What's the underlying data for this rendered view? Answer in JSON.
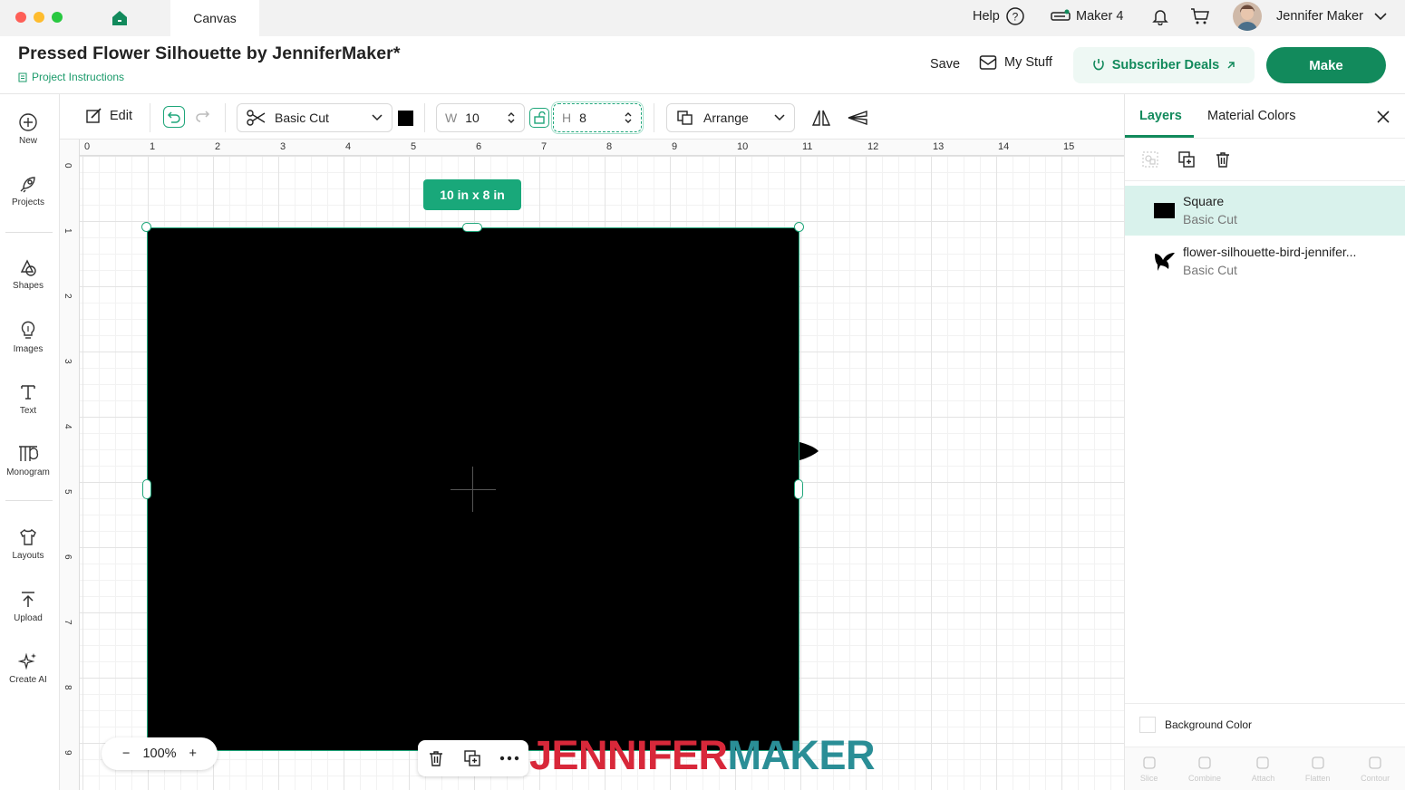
{
  "window": {
    "tab_label": "Canvas"
  },
  "topbar": {
    "help_label": "Help",
    "machine_label": "Maker 4",
    "user_name": "Jennifer Maker"
  },
  "header": {
    "project_title": "Pressed Flower Silhouette by JenniferMaker*",
    "project_instructions": "Project Instructions",
    "save_label": "Save",
    "mystuff_label": "My Stuff",
    "deals_label": "Subscriber Deals",
    "make_label": "Make"
  },
  "sidebar": {
    "items": [
      {
        "label": "New",
        "icon": "plus-circle-icon"
      },
      {
        "label": "Projects",
        "icon": "rocket-icon"
      },
      {
        "label": "Shapes",
        "icon": "shapes-icon"
      },
      {
        "label": "Images",
        "icon": "lightbulb-icon"
      },
      {
        "label": "Text",
        "icon": "text-icon"
      },
      {
        "label": "Monogram",
        "icon": "monogram-icon"
      },
      {
        "label": "Layouts",
        "icon": "shirt-icon"
      },
      {
        "label": "Upload",
        "icon": "upload-icon"
      },
      {
        "label": "Create AI",
        "icon": "sparkle-icon"
      }
    ]
  },
  "toolbar": {
    "edit_label": "Edit",
    "operation_label": "Basic Cut",
    "width_prefix": "W",
    "width_value": "10",
    "height_prefix": "H",
    "height_value": "8",
    "arrange_label": "Arrange",
    "swatch_color": "#000000"
  },
  "canvas": {
    "ruler_top": [
      "0",
      "1",
      "2",
      "3",
      "4",
      "5",
      "6",
      "7",
      "8",
      "9",
      "10",
      "11",
      "12",
      "13",
      "14",
      "15"
    ],
    "ruler_left": [
      "0",
      "1",
      "2",
      "3",
      "4",
      "5",
      "6",
      "7",
      "8",
      "9"
    ],
    "dimension_badge": "10  in x 8  in",
    "zoom_level": "100%",
    "zoom_minus": "−",
    "zoom_plus": "+"
  },
  "watermark": {
    "part1": "JENNIFER",
    "part2": "MAKER",
    "color1": "#d8283a",
    "color2": "#2a8e96"
  },
  "panel": {
    "tab_layers": "Layers",
    "tab_material_colors": "Material Colors",
    "layers": [
      {
        "name": "Square",
        "operation": "Basic Cut"
      },
      {
        "name": "flower-silhouette-bird-jennifer...",
        "operation": "Basic Cut"
      }
    ],
    "background_color_label": "Background Color",
    "bottom_actions": [
      "Slice",
      "Combine",
      "Attach",
      "Flatten",
      "Contour"
    ]
  },
  "colors": {
    "accent": "#128a5c",
    "selection": "#1fa67a",
    "badge": "#19a87a",
    "layer_selected_bg": "#d9f2ec"
  }
}
